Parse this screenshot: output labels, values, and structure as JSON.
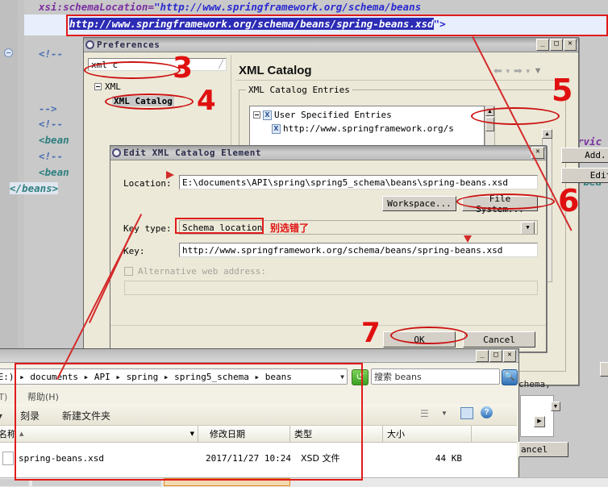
{
  "editor": {
    "line1": "xsi:schemaLocation=\"http://www.springframework.org/schema/beans",
    "line1_attr": "xsi:schemaLocation=",
    "line1_str": "\"http://www.springframework.org/schema/beans",
    "line2_selected": "http://www.springframework.org/schema/beans/spring-beans.xsd",
    "line2_tail": "\">",
    "comment1": "<!--",
    "comment_end": "-->",
    "comment2": "<!--",
    "bean1": "<bean",
    "comment3": "<!--",
    "bean2": "<bean",
    "close_beans": "</beans>",
    "right_frag1": "rvic",
    "right_frag2": "/bea"
  },
  "preferences": {
    "title": "Preferences",
    "filter_value": "xml c",
    "tree": [
      {
        "label": "XML",
        "level": 0
      },
      {
        "label": "XML Catalog",
        "level": 1
      }
    ],
    "page_title": "XML Catalog",
    "group_caption": "XML Catalog Entries",
    "entries": [
      {
        "label": "User Specified Entries",
        "level": 0
      },
      {
        "label": "http://www.springframework.org/s",
        "level": 1
      }
    ],
    "buttons": {
      "add": "Add...",
      "edit": "Edit",
      "cancel": "ancel"
    },
    "nav": {
      "back": "back-arrow",
      "forward": "forward-arrow",
      "menu": "dropdown-arrow"
    },
    "window_controls": {
      "minimize": "_",
      "maximize": "□",
      "close": "✕"
    }
  },
  "edit_dialog": {
    "title": "Edit XML Catalog Element",
    "close": "✕",
    "location_label": "Location:",
    "location_value": "E:\\documents\\API\\spring\\spring5_schema\\beans\\spring-beans.xsd",
    "workspace_button": "Workspace...",
    "filesystem_button": "File System...",
    "key_type_label": "Key type:",
    "key_type_value": "Schema location",
    "key_type_note": "别选错了",
    "key_label": "Key:",
    "key_value": "http://www.springframework.org/schema/beans/spring-beans.xsd",
    "alt_checkbox_label": "Alternative web address:",
    "alt_value": "",
    "ok_button": "OK",
    "cancel_button": "Cancel"
  },
  "explorer": {
    "breadcrumb": "(E:) ▸ documents ▸ API ▸ spring ▸ spring5_schema ▸ beans",
    "breadcrumb_parts": [
      "(E:)",
      "documents",
      "API",
      "spring",
      "spring5_schema",
      "beans"
    ],
    "search_placeholder": "搜索 beans",
    "menu": [
      "具(T)",
      "帮助(H)"
    ],
    "toolbar": [
      "刻录",
      "新建文件夹"
    ],
    "organize_label": "组 ▾",
    "columns": [
      "名称",
      "修改日期",
      "类型",
      "大小"
    ],
    "sort_indicator": "▲",
    "rows": [
      {
        "name": "spring-beans.xsd",
        "date": "2017/11/27 10:24",
        "type": "XSD 文件",
        "size": "44 KB"
      }
    ],
    "window_controls": {
      "minimize": "_",
      "maximize": "□",
      "close": "✕"
    },
    "right_frag": "chema,",
    "refresh_icon": "refresh-icon",
    "search_icon": "search-icon",
    "help_icon": "help-icon",
    "view_icon": "view-mode-icon"
  },
  "annotations": {
    "n3": "3",
    "n4": "4",
    "n5": "5",
    "n6": "6",
    "n7": "7"
  },
  "colors": {
    "annotation_red": "#e01010",
    "selection_blue": "#2b2bb5",
    "dialog_face": "#ece9d8"
  }
}
